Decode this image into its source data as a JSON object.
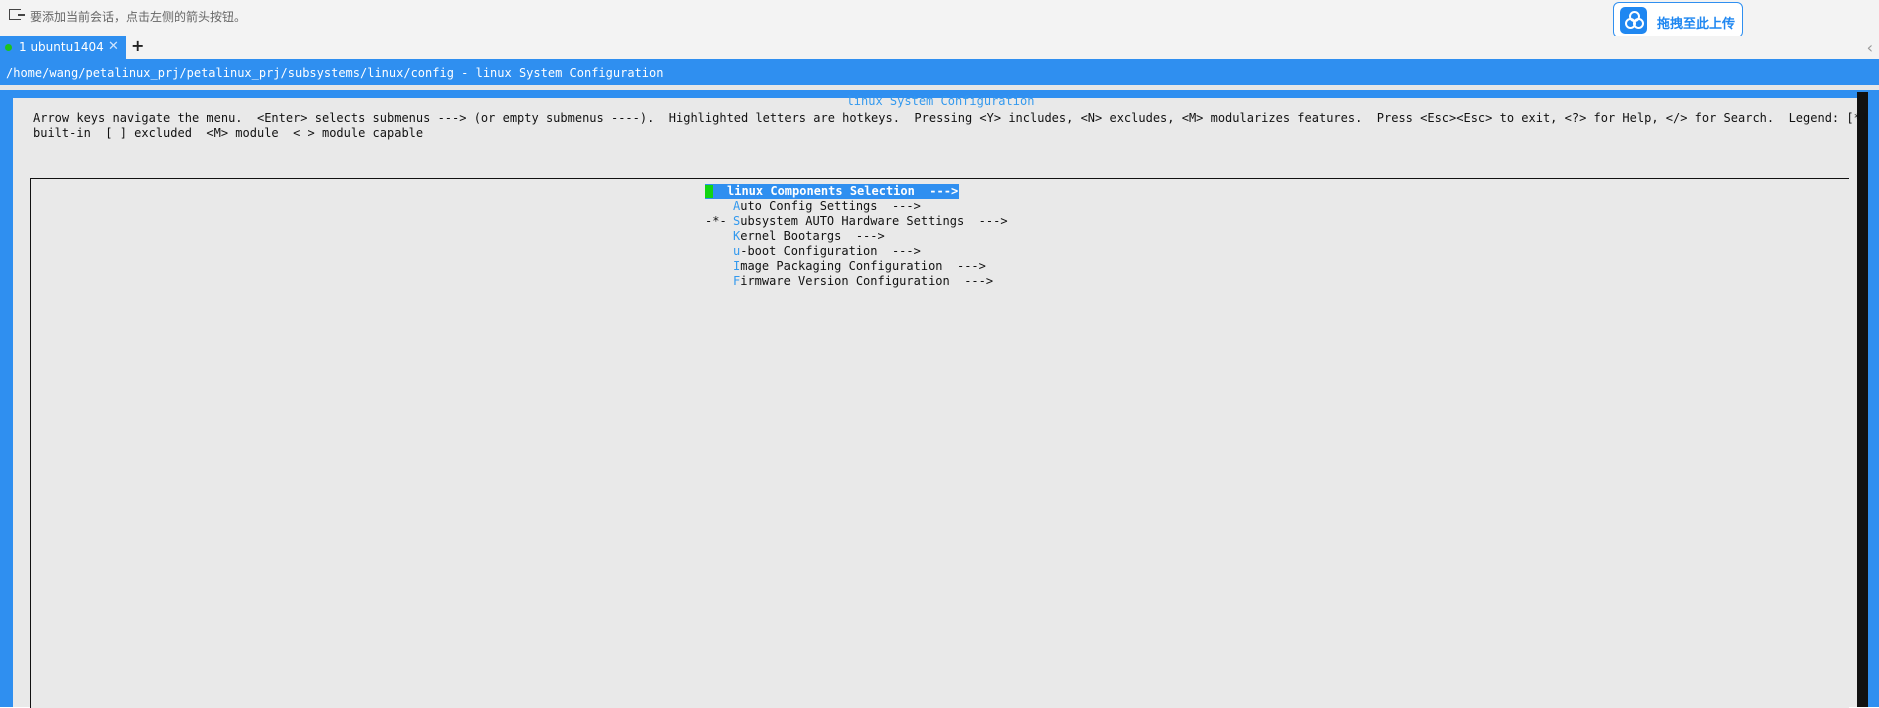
{
  "topbar": {
    "hint": "要添加当前会话，点击左侧的箭头按钮。",
    "upload_label": "拖拽至此上传",
    "colors": {
      "accent": "#2f8ff0",
      "upload": "#1f87f1"
    }
  },
  "tabs": [
    {
      "label": "1 ubuntu1404",
      "close": "✕",
      "status_color": "#1dc21d"
    }
  ],
  "tabbar": {
    "add": "+",
    "collapse": "‹"
  },
  "terminal": {
    "path": "/home/wang/petalinux_prj/petalinux_prj/subsystems/linux/config - linux System Configuration"
  },
  "dialog": {
    "title": "linux System Configuration",
    "help_line1": "Arrow keys navigate the menu.  <Enter> selects submenus ---> (or empty submenus ----).  Highlighted letters are hotkeys.  Pressing <Y> includes, <N> excludes, <M> modularizes features.  Press <Esc><Esc> to exit, <?> for Help, </> for Search.  Legend: [*]",
    "help_line2": "built-in  [ ] excluded  <M> module  < > module capable",
    "menu": [
      {
        "prefix": "",
        "hotkey": "l",
        "rest": "inux Components Selection  --->",
        "selected": true
      },
      {
        "prefix": "",
        "hotkey": "A",
        "rest": "uto Config Settings  --->",
        "selected": false
      },
      {
        "prefix": "-*-",
        "hotkey": "S",
        "rest": "ubsystem AUTO Hardware Settings  --->",
        "selected": false
      },
      {
        "prefix": "",
        "hotkey": "K",
        "rest": "ernel Bootargs  --->",
        "selected": false
      },
      {
        "prefix": "",
        "hotkey": "u",
        "rest": "-boot Configuration  --->",
        "selected": false
      },
      {
        "prefix": "",
        "hotkey": "I",
        "rest": "mage Packaging Configuration  --->",
        "selected": false
      },
      {
        "prefix": "",
        "hotkey": "F",
        "rest": "irmware Version Configuration  --->",
        "selected": false
      }
    ]
  }
}
